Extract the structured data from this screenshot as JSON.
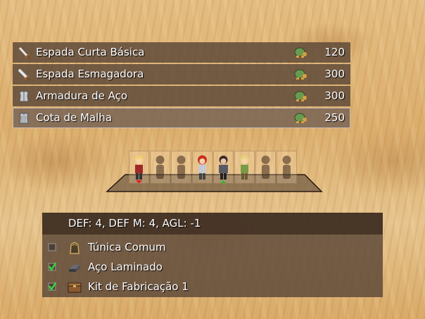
{
  "shop": {
    "items": [
      {
        "name": "Espada Curta Básica",
        "icon": "short-sword-icon",
        "price": "120"
      },
      {
        "name": "Espada Esmagadora",
        "icon": "broad-sword-icon",
        "price": "300"
      },
      {
        "name": "Armadura de Aço",
        "icon": "steel-armor-icon",
        "price": "300"
      },
      {
        "name": "Cota de Malha",
        "icon": "chainmail-icon",
        "price": "250"
      }
    ],
    "currency_icon": "turtle-coin-icon",
    "selected_index": 3
  },
  "party": {
    "members": [
      {
        "state": "character",
        "icon": "blonde-hero-sprite",
        "marker": "down"
      },
      {
        "state": "empty",
        "icon": "silhouette-icon"
      },
      {
        "state": "empty",
        "icon": "silhouette-icon"
      },
      {
        "state": "character",
        "icon": "red-hair-hero-sprite"
      },
      {
        "state": "character",
        "icon": "dark-knight-sprite",
        "marker": "up"
      },
      {
        "state": "character",
        "icon": "green-elf-sprite"
      },
      {
        "state": "empty",
        "icon": "silhouette-icon"
      },
      {
        "state": "empty",
        "icon": "silhouette-icon"
      }
    ],
    "marker_colors": {
      "down": "#e02020",
      "up": "#20c020"
    }
  },
  "details": {
    "stats": "DEF: 4, DEF M: 4, AGL: -1",
    "requirements": [
      {
        "label": "Túnica Comum",
        "icon": "tunic-icon",
        "checked": false
      },
      {
        "label": "Aço Laminado",
        "icon": "steel-ingot-icon",
        "checked": true
      },
      {
        "label": "Kit de Fabricação 1",
        "icon": "crafting-kit-icon",
        "checked": true
      }
    ]
  }
}
